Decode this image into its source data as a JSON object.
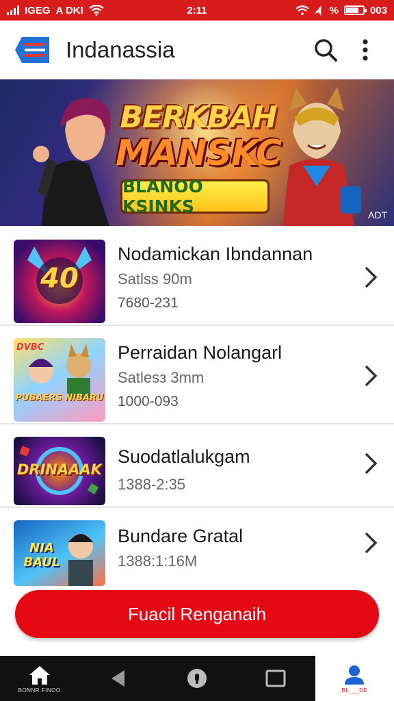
{
  "status_bar": {
    "carrier": "IGEG",
    "network": "A DKI",
    "time": "2:11",
    "battery_text": "%",
    "battery_percent_display": "003",
    "battery_level": 0.75
  },
  "app_bar": {
    "title": "Indanassia",
    "logo_icon": "list-logo-icon",
    "search_icon": "search-icon",
    "menu_icon": "more-vert-icon"
  },
  "banner": {
    "title_line1": "BERKBAH",
    "title_line2": "MANSKC",
    "pill_text": "BLANOO KSINKS",
    "badge": "ADT"
  },
  "games": [
    {
      "name": "Nodamickan Ibndannan",
      "subtitle": "Satlss 90m",
      "code": "7680-231",
      "thumb_text": "40",
      "thumb_colors": [
        "#5a1a9a",
        "#c2185b",
        "#1e88e5"
      ]
    },
    {
      "name": "Perraidan Nolangarl",
      "subtitle": "Satlesз 3mm",
      "code": "1000-093",
      "thumb_text": "PUBAERS NIBARU",
      "thumb_badge": "DVBC",
      "thumb_colors": [
        "#ffcf3a",
        "#7ec8ff",
        "#ff8ab0"
      ]
    },
    {
      "name": "Suodatlalukgam",
      "subtitle": "1388-2:35",
      "code": "",
      "thumb_text": "DRINAAAK",
      "thumb_colors": [
        "#3a0d5a",
        "#1a237e",
        "#ff6f00"
      ]
    },
    {
      "name": "Bundare Gratal",
      "subtitle": "1388:1:16M",
      "code": "",
      "thumb_text": "NIA BAUL",
      "thumb_colors": [
        "#1565c0",
        "#4fc3f7",
        "#ff7043"
      ]
    }
  ],
  "cta": {
    "label": "Fuacil Renganaih"
  },
  "nav": {
    "home_label": "BONNR FINOO",
    "back_icon": "back-triangle-icon",
    "center_icon": "lock-circle-icon",
    "recents_icon": "recents-square-icon",
    "profile_label": "BL___DE"
  }
}
